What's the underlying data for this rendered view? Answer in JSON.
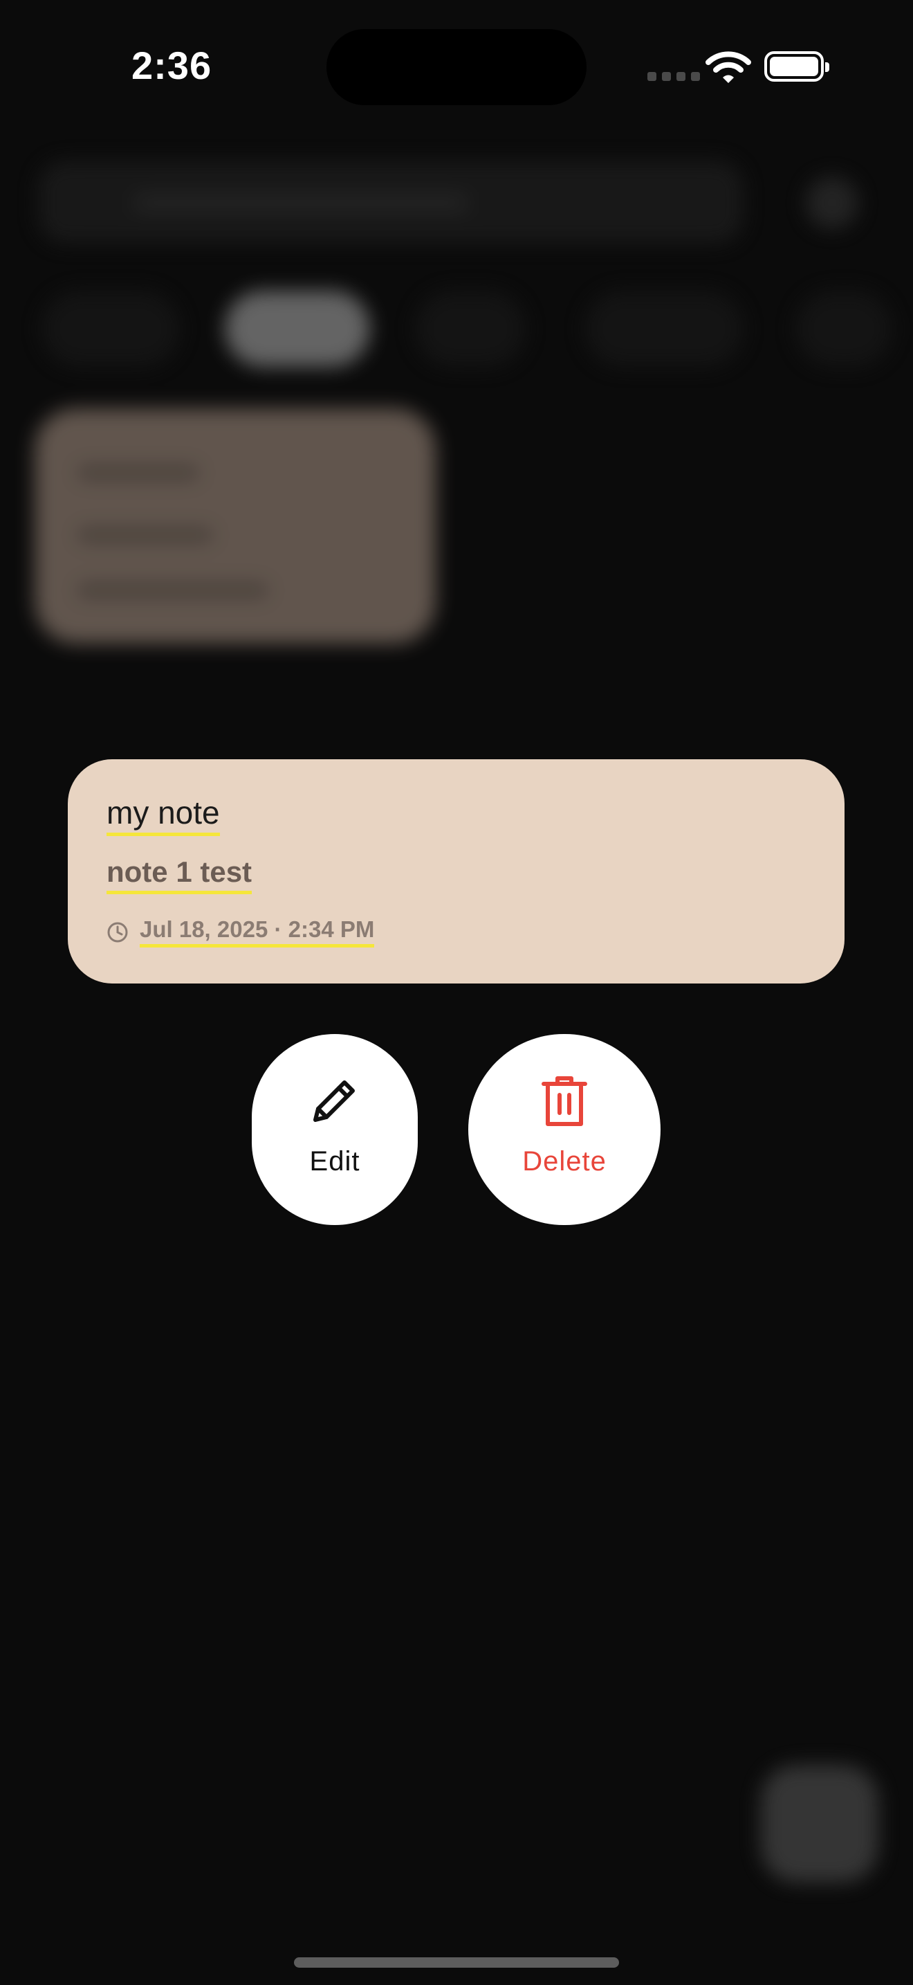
{
  "status_bar": {
    "time": "2:36",
    "icons": [
      "cellular-icon",
      "wifi-icon",
      "battery-icon"
    ]
  },
  "focused_note": {
    "title": "my note",
    "body": "note 1 test",
    "date": "Jul 18, 2025 · 2:34 PM",
    "background_color": "#e8d4c2",
    "highlight_color": "#f5e63a",
    "icons": [
      "clock-icon"
    ]
  },
  "context_menu": {
    "edit": {
      "label": "Edit",
      "icon": "pencil-icon"
    },
    "delete": {
      "label": "Delete",
      "icon": "trash-icon",
      "color": "#e8453a"
    }
  }
}
